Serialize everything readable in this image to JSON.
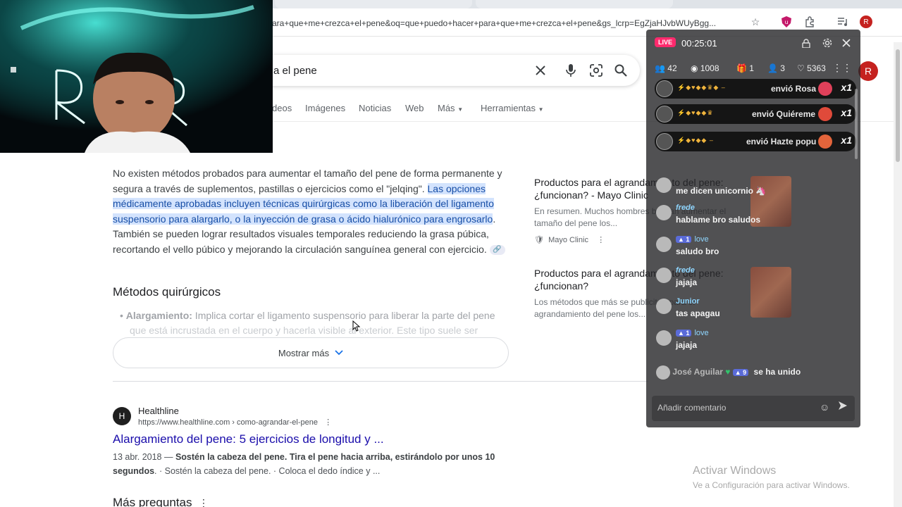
{
  "browser": {
    "url": "ara+que+me+crezca+el+pene&oq=que+puedo+hacer+para+que+me+crezca+el+pene&gs_lcrp=EgZjaHJvbWUyBgg...",
    "profile_initial": "R"
  },
  "search": {
    "query": "a el pene",
    "avatar_initial": "R"
  },
  "tabs": [
    "deos",
    "Imágenes",
    "Noticias",
    "Web",
    "Más",
    "Herramientas"
  ],
  "overview": {
    "p1": "No existen métodos probados para aumentar el tamaño del pene de forma permanente y segura a través de suplementos, pastillas o ejercicios como el \"jelqing\". ",
    "p1_highlight": "Las opciones médicamente aprobadas incluyen técnicas quirúrgicas como la liberación del ligamento suspensorio para alargarlo, o la inyección de grasa o ácido hialurónico para engrosarlo",
    "p1_end": ". También se pueden lograr resultados visuales temporales reduciendo la grasa púbica, recortando el vello púbico y mejorando la circulación sanguínea general con ejercicio.",
    "heading": "Métodos quirúrgicos",
    "bullet_label": "Alargamiento:",
    "bullet_text": " Implica cortar el ligamento suspensorio para liberar la parte del pene",
    "bullet_text2": "que está incrustada en el cuerpo y hacerla visible al exterior. Este tipo suele ser",
    "show_more": "Mostrar más"
  },
  "cards": [
    {
      "title": "Productos para el agrandamiento del pene: ¿funcionan? - Mayo Clinic",
      "snippet": "En resumen. Muchos hombres buscan aumentar el tamaño del pene los...",
      "source": "Mayo Clinic"
    },
    {
      "title": "Productos para el agrandamiento del pene: ¿funcionan?",
      "snippet": "Los métodos que más se publicitan para el agrandamiento del pene los...",
      "source": ""
    }
  ],
  "result": {
    "site": "Healthline",
    "url": "https://www.healthline.com › como-agrandar-el-pene",
    "title": "Alargamiento del pene: 5 ejercicios de longitud y ...",
    "date": "13 abr. 2018 — ",
    "snippet_bold": "Sostén la cabeza del pene. Tira el pene hacia arriba, estirándolo por unos 10 segundos",
    "snippet_rest": ". · Sostén la cabeza del pene. · Coloca el dedo índice y ..."
  },
  "more_questions": "Más preguntas",
  "live": {
    "badge": "LIVE",
    "time": "00:25:01",
    "stats": {
      "viewers": "42",
      "views": "1008",
      "gifts": "1",
      "followers": "3",
      "likes": "5363"
    },
    "gifts": [
      {
        "text": "envió Rosa",
        "mult": "x1",
        "color": "#e0405a"
      },
      {
        "text": "envió Quiéreme",
        "mult": "x1",
        "color": "#e04a3a"
      },
      {
        "text": "envió Hazte popu",
        "mult": "x1",
        "color": "#e3643b"
      }
    ],
    "messages": [
      {
        "name": "",
        "level": "",
        "text": "me dicen unicornio 🦄",
        "name_color": "#8fd6ff"
      },
      {
        "name": "frede",
        "level": "",
        "text": "hablame bro saludos",
        "name_color": "#8fd6ff"
      },
      {
        "name": "love",
        "level": "1",
        "text": "saludo bro",
        "name_color": "#8fd6ff"
      },
      {
        "name": "frede",
        "level": "",
        "text": "jajaja",
        "name_color": "#8fd6ff"
      },
      {
        "name": "Junior",
        "level": "",
        "text": "tas apagau",
        "name_color": "#8fd6ff"
      },
      {
        "name": "love",
        "level": "1",
        "text": "jajaja",
        "name_color": "#8fd6ff"
      }
    ],
    "join": {
      "name": "José Aguilar",
      "level": "9",
      "text": "se ha unido"
    },
    "comment_placeholder": "Añadir comentario"
  },
  "windows": {
    "line1": "Activar Windows",
    "line2": "Ve a Configuración para activar Windows."
  }
}
